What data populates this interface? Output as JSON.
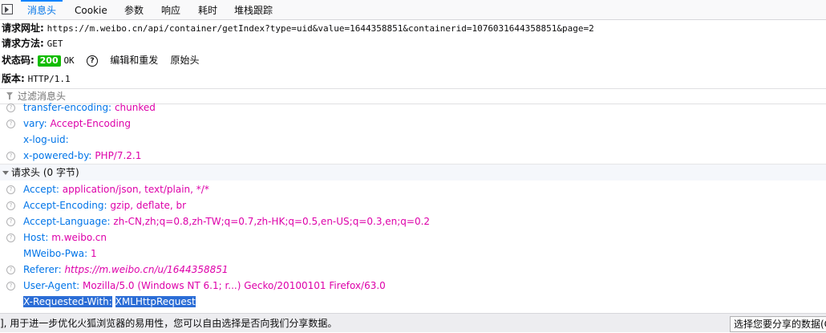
{
  "tabs": [
    {
      "label": "消息头",
      "active": true
    },
    {
      "label": "Cookie"
    },
    {
      "label": "参数"
    },
    {
      "label": "响应"
    },
    {
      "label": "耗时"
    },
    {
      "label": "堆栈跟踪"
    }
  ],
  "summary": {
    "url_label": "请求网址:",
    "url": "https://m.weibo.cn/api/container/getIndex?type=uid&value=1644358851&containerid=1076031644358851&page=2",
    "method_label": "请求方法:",
    "method": "GET",
    "status_label": "状态码:",
    "status_code": "200",
    "status_text": "OK",
    "help_icon": "?",
    "edit_resend": "编辑和重发",
    "raw_headers": "原始头",
    "version_label": "版本:",
    "version": "HTTP/1.1"
  },
  "filter": {
    "placeholder": "过滤消息头"
  },
  "response_headers_tail": [
    {
      "name": "transfer-encoding:",
      "value": "chunked",
      "help": true
    },
    {
      "name": "vary:",
      "value": "Accept-Encoding",
      "help": true
    },
    {
      "name": "x-log-uid:",
      "value": "",
      "help": false
    },
    {
      "name": "x-powered-by:",
      "value": "PHP/7.2.1",
      "help": true
    }
  ],
  "request_section": {
    "title": "请求头 (0 字节)"
  },
  "request_headers": [
    {
      "name": "Accept:",
      "value": "application/json, text/plain, */*",
      "help": true
    },
    {
      "name": "Accept-Encoding:",
      "value": "gzip, deflate, br",
      "help": true
    },
    {
      "name": "Accept-Language:",
      "value": "zh-CN,zh;q=0.8,zh-TW;q=0.7,zh-HK;q=0.5,en-US;q=0.3,en;q=0.2",
      "help": true
    },
    {
      "name": "Host:",
      "value": "m.weibo.cn",
      "help": true
    },
    {
      "name": "MWeibo-Pwa:",
      "value": "1",
      "help": false
    },
    {
      "name": "Referer:",
      "value": "https://m.weibo.cn/u/1644358851",
      "help": true
    },
    {
      "name": "User-Agent:",
      "value": "Mozilla/5.0 (Windows NT 6.1; r...) Gecko/20100101 Firefox/63.0",
      "help": true
    },
    {
      "name": "X-Requested-With:",
      "value": "XMLHttpRequest",
      "help": false
    }
  ],
  "notice": {
    "text": "], 用于进一步优化火狐浏览器的易用性，您可以自由选择是否向我们分享数据。",
    "button": "选择您要分享的数据(C)"
  },
  "colors": {
    "accent": "#0074e8",
    "header_value": "#dd00a9",
    "status_ok": "#12bc00",
    "selection": "#2b6dd6"
  }
}
